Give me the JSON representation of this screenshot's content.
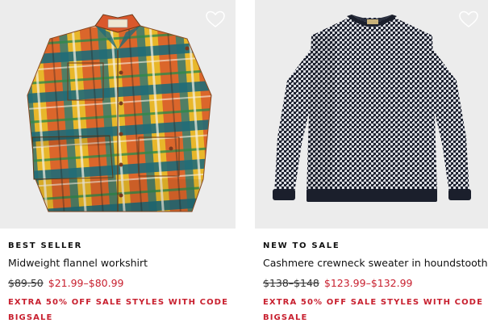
{
  "products": [
    {
      "badge": "BEST SELLER",
      "name": "Midweight flannel workshirt",
      "original_price": "$89.50",
      "sale_price": "$21.99–$80.99",
      "promo": "EXTRA 50% OFF SALE STYLES WITH CODE BIGSALE",
      "wishlist_icon": "heart-outline-icon"
    },
    {
      "badge": "NEW TO SALE",
      "name": "Cashmere crewneck sweater in houndstooth",
      "original_price": "$138–$148",
      "sale_price": "$123.99–$132.99",
      "promo": "EXTRA 50% OFF SALE STYLES WITH CODE BIGSALE",
      "wishlist_icon": "heart-outline-icon"
    }
  ],
  "colors": {
    "image_background": "#ececec",
    "sale_red": "#c8202f",
    "text": "#111111"
  }
}
